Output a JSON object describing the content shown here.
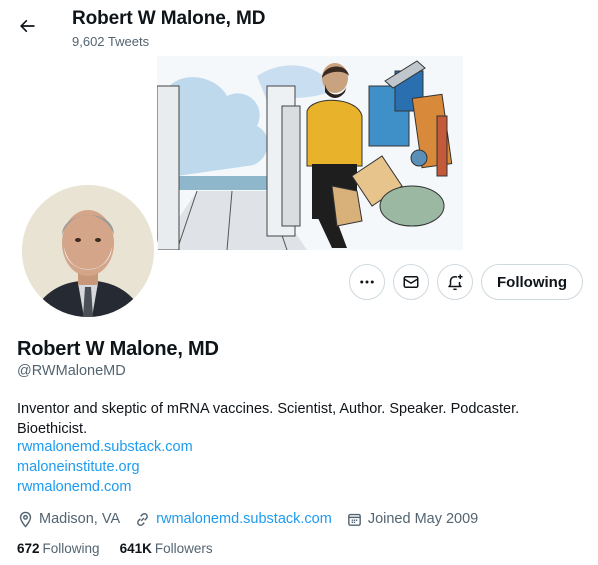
{
  "header": {
    "name": "Robert W Malone, MD",
    "tweet_count": "9,602 Tweets"
  },
  "profile": {
    "name": "Robert W Malone, MD",
    "handle": "@RWMaloneMD",
    "bio": "Inventor and skeptic of mRNA vaccines. Scientist, Author. Speaker. Podcaster. Bioethicist.",
    "bio_links": [
      "rwmalonemd.substack.com",
      "maloneinstitute.org",
      "rwmalonemd.com"
    ]
  },
  "actions": {
    "follow_label": "Following"
  },
  "meta": {
    "location": "Madison, VA",
    "website": "rwmalonemd.substack.com",
    "joined": "Joined May 2009"
  },
  "stats": {
    "following_count": "672",
    "following_label": "Following",
    "followers_count": "641K",
    "followers_label": "Followers"
  },
  "icons": {
    "back": "arrow-left-icon",
    "more": "more-dots-icon",
    "message": "envelope-icon",
    "notify": "bell-plus-icon",
    "location": "location-pin-icon",
    "link": "link-icon",
    "calendar": "calendar-icon"
  },
  "colors": {
    "accent": "#1d9bf0",
    "text": "#0f1419",
    "muted": "#536471",
    "border": "#cfd9de"
  }
}
